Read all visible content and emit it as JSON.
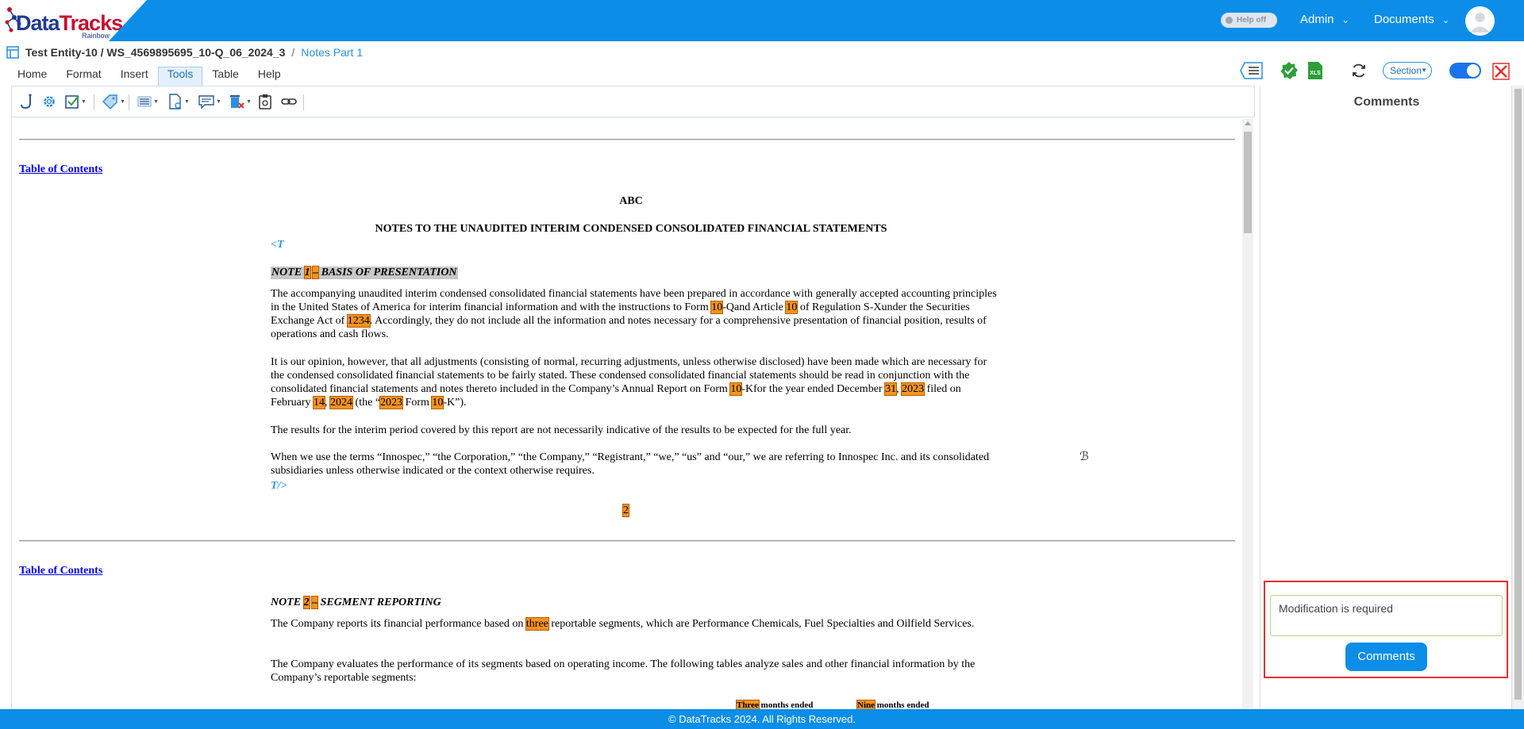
{
  "app": {
    "logo_text_1": "Data",
    "logo_text_2": "Tracks",
    "logo_sub": "Rainbow",
    "help_toggle_label": "Help off",
    "admin_menu": "Admin",
    "documents_menu": "Documents",
    "brand_color": "#0b8de8"
  },
  "breadcrumb": {
    "entity_path": "Test Entity-10 / WS_4569895695_10-Q_06_2024_3",
    "separator": "/",
    "current": "Notes Part 1"
  },
  "menu_tabs": [
    {
      "label": "Home"
    },
    {
      "label": "Format"
    },
    {
      "label": "Insert"
    },
    {
      "label": "Tools",
      "active": true
    },
    {
      "label": "Table"
    },
    {
      "label": "Help"
    }
  ],
  "header_tools": {
    "section_select": "Section"
  },
  "document": {
    "toc_link_1": "Table of Contents",
    "toc_link_2": "Table of Contents",
    "company": "ABC",
    "main_title": "NOTES TO THE UNAUDITED INTERIM CONDENSED CONSOLIDATED FINANCIAL STATEMENTS",
    "tag_open": "<T",
    "tag_close": "T/>",
    "note1_prefix": "NOTE ",
    "note1_num": "1",
    "note1_dash": "–",
    "note1_title": " BASIS OF PRESENTATION",
    "p1_a": "The accompanying unaudited interim condensed consolidated financial statements have been prepared in accordance with generally accepted accounting principles in the United States of America for interim financial information and with the instructions to Form ",
    "p1_h1": "10",
    "p1_b": "-Qand Article ",
    "p1_h2": "10",
    "p1_c": " of Regulation S-Xunder the Securities Exchange Act of ",
    "p1_h3": "1234",
    "p1_d": ". Accordingly, they do not include all the information and notes necessary for a comprehensive presentation of financial position, results of operations and cash flows.",
    "p2_a": "It is our opinion, however, that all adjustments (consisting of normal, recurring adjustments, unless otherwise disclosed) have been made which are necessary for the condensed consolidated financial statements to be fairly stated. These condensed consolidated financial statements should be read in conjunction with the consolidated financial statements and notes thereto included in the Company’s Annual Report on Form ",
    "p2_h1": "10",
    "p2_b": "-Kfor the year ended December ",
    "p2_h2": "31",
    "p2_c": ", ",
    "p2_h3": "2023",
    "p2_d": " filed on February ",
    "p2_h4": "14",
    "p2_e": ", ",
    "p2_h5": "2024",
    "p2_f": " (the “",
    "p2_h6": "2023",
    "p2_g": " Form ",
    "p2_h7": "10",
    "p2_h": "-K”).",
    "p3": "The results for the interim period covered by this report are not necessarily indicative of the results to be expected for the full year.",
    "p4": "When we use the terms “Innospec,” “the Corporation,” “the Company,” “Registrant,” “we,” “us” and “our,” we are referring to Innospec Inc. and its consolidated subsidiaries unless otherwise indicated or the context otherwise requires.",
    "page_number": "2",
    "note2_prefix": "NOTE ",
    "note2_num": "2",
    "note2_dash": "–",
    "note2_title": " SEGMENT REPORTING",
    "p5_a": "The Company reports its financial performance based on ",
    "p5_h1": "three",
    "p5_b": " reportable segments, which are Performance Chemicals, Fuel Specialties and Oilfield Services.",
    "p6": "The Company evaluates the performance of its segments based on operating income. The following tables analyze sales and other financial information by the Company’s reportable segments:",
    "col1_h": "Three",
    "col1_rest": " months ended",
    "col2_h": "Nine",
    "col2_rest": " months ended"
  },
  "comments": {
    "title": "Comments",
    "input_value": "Modification is required",
    "button_label": "Comments"
  },
  "footer": {
    "text": "© DataTracks 2024. All Rights Reserved."
  }
}
